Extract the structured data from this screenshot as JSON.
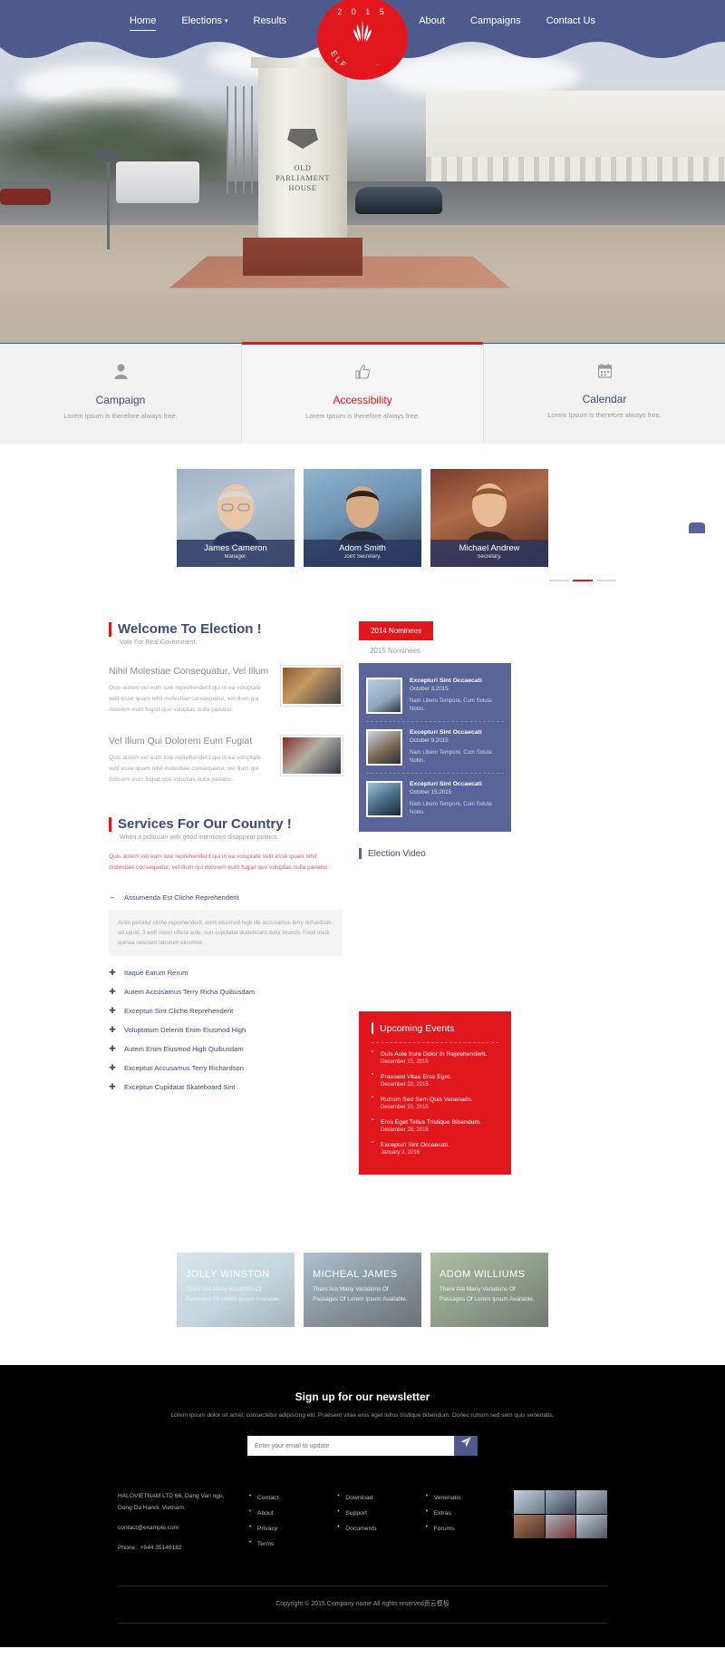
{
  "nav": {
    "items": [
      {
        "label": "Home",
        "active": true,
        "dropdown": false
      },
      {
        "label": "Elections",
        "active": false,
        "dropdown": true
      },
      {
        "label": "Results",
        "active": false,
        "dropdown": false
      },
      {
        "label": "About",
        "active": false,
        "dropdown": false
      },
      {
        "label": "Campaigns",
        "active": false,
        "dropdown": false
      },
      {
        "label": "Contact Us",
        "active": false,
        "dropdown": false
      }
    ],
    "logo": {
      "year": "2 0 1 5",
      "word": "ELECTION",
      "color": "#e2171e"
    }
  },
  "hero": {
    "monument_text": "OLD\nPARLIAMENT\nHOUSE",
    "monument_line1": "OLD",
    "monument_line2": "PARLIAMENT",
    "monument_line3": "HOUSE"
  },
  "features": [
    {
      "icon": "user-icon",
      "glyph": "👤",
      "title": "Campaign",
      "desc": "Lorem Ipsum is therefore always free.",
      "active": false
    },
    {
      "icon": "thumbs-up-icon",
      "glyph": "👍",
      "title": "Accessibility",
      "desc": "Lorem Ipsum is therefore always free.",
      "active": true
    },
    {
      "icon": "calendar-icon",
      "glyph": "📅",
      "title": "Calendar",
      "desc": "Lorem Ipsum is therefore always free.",
      "active": false
    }
  ],
  "team": [
    {
      "name": "James Cameron",
      "role": "Manager."
    },
    {
      "name": "Adom Smith",
      "role": "Joint Secretary."
    },
    {
      "name": "Michael Andrew",
      "role": "Secretary."
    }
  ],
  "welcome": {
    "title": "Welcome To Election !",
    "subtitle": "Vote For Real Government.",
    "posts": [
      {
        "title": "Nihil Molestiae Consequatur, Vel Illum",
        "text": "Quis autem vel eum iure reprehenderit qui in ea voluptate velit esse quam nihil molestiae consequatur, vel illum qui dolorem eum fugiat quo voluptas nulla pariatur."
      },
      {
        "title": "Vel Illum Qui Dolorem Eum Fugiat",
        "text": "Quis autem vel eum iure reprehenderit qui in ea voluptate velit esse quam nihil molestiae consequatur, vel illum qui dolorem eum fugiat quo voluptas nulla pariatur."
      }
    ]
  },
  "services": {
    "title": "Services For Our Country !",
    "subtitle": "When a politician with good intentions disappear politics.",
    "lead": "Quis autem vel eum iure reprehenderit qui in ea voluptate velit esse quam nihil molestiae consequatur, vel illum qui dolorem eum fugiat quo voluptas nulla pariatur.",
    "accordion": [
      {
        "sym": "–",
        "label": "Assumenda Est Cliche Reprehenderit",
        "open": true,
        "body": "Anim pariatur cliche reprehenderit, enim eiusmod high life accusamus terry richardson ad squid. 3 wolf moon officia aute, non cupidatat skateboard dolor brunch. Food truck quinoa nesciunt laborum eiusmod."
      },
      {
        "sym": "✚",
        "label": "Itaque Earum Rerum",
        "open": false,
        "body": ""
      },
      {
        "sym": "✚",
        "label": "Autem Accusamus Terry Richa Quibusdam",
        "open": false,
        "body": ""
      },
      {
        "sym": "✚",
        "label": "Excepturi Sint Cliche Reprehenderit",
        "open": false,
        "body": ""
      },
      {
        "sym": "✚",
        "label": "Voluptatum Deleniti Enim Eiusmod High",
        "open": false,
        "body": ""
      },
      {
        "sym": "✚",
        "label": "Autem Enim Eiusmod High Quibusdam",
        "open": false,
        "body": ""
      },
      {
        "sym": "✚",
        "label": "Excepturi Accusamus Terry Richardson",
        "open": false,
        "body": ""
      },
      {
        "sym": "✚",
        "label": "Excepturi Cupidatat Skateboard Sint",
        "open": false,
        "body": ""
      }
    ]
  },
  "nominees": {
    "tab_active": "2014 Nominees",
    "tab_inactive": "2015 Nominees",
    "items": [
      {
        "title": "Excepturi Sint Occaecati",
        "date": "October 3,2015",
        "text": "Nam Libero Tempore, Cum Soluta Nobis."
      },
      {
        "title": "Excepturi Sint Occaecati",
        "date": "October 9,2015",
        "text": "Nam Libero Tempore, Cum Soluta Nobis."
      },
      {
        "title": "Excepturi Sint Occaecati",
        "date": "October 15,2015",
        "text": "Nam Libero Tempore, Cum Soluta Nobis."
      }
    ],
    "video_title": "Election Video"
  },
  "events": {
    "title": "Upcoming Events",
    "items": [
      {
        "title": "Duis Aute Irure Dolor In Reprehenderit.",
        "date": "December 15, 2015"
      },
      {
        "title": "Praesent Vitae Eros Eget.",
        "date": "December 20, 2015"
      },
      {
        "title": "Rutrum Sed Sem Quis Venenatis.",
        "date": "December 25, 2015"
      },
      {
        "title": "Eros Eget Tellus Tristique Bibendum.",
        "date": "December 28, 2015"
      },
      {
        "title": "Excepturi Sint Occaecati.",
        "date": "January 3, 2016"
      }
    ]
  },
  "gallery": [
    {
      "name": "JOLLY WINSTON",
      "text": "There Are Many Variations Of Passages Of Lorem Ipsum Available."
    },
    {
      "name": "MICHEAL JAMES",
      "text": "There Are Many Variations Of Passages Of Lorem Ipsum Available."
    },
    {
      "name": "ADOM WILLIUMS",
      "text": "There Are Many Variations Of Passages Of Lorem Ipsum Available."
    }
  ],
  "footer": {
    "newsletter_title": "Sign up for our newsletter",
    "newsletter_text": "Lorem ipsum dolor sit amet, consectetur adipiscing elit. Praesent vitae eros eget tellus tristique bibendum. Donec rutrum sed sem quis venenatis.",
    "email_placeholder": "Enter your email to update",
    "send_icon": "paper-plane-icon",
    "address": "HALOVIETNAM LTD 66, Dang Van ngu, Dong Da Hanoi, Vietnam.",
    "email": "contact@example.com",
    "phone": "Phone : +844 35149182",
    "links_col1": [
      "Contact",
      "About",
      "Privacy",
      "Terms"
    ],
    "links_col2": [
      "Download",
      "Support",
      "Documents"
    ],
    "links_col3": [
      "Venenatis",
      "Extras",
      "Forums"
    ],
    "copyright": "Copyright © 2015.Company name All rights reserved贡云模板"
  }
}
